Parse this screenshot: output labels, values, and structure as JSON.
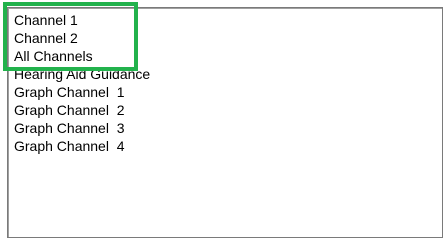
{
  "listbox": {
    "items": [
      "Channel 1",
      "Channel 2",
      "All Channels",
      "Hearing Aid Guidance",
      "Graph Channel  1",
      "Graph Channel  2",
      "Graph Channel  3",
      "Graph Channel  4"
    ]
  },
  "highlight": {
    "color": "#22b24c"
  }
}
